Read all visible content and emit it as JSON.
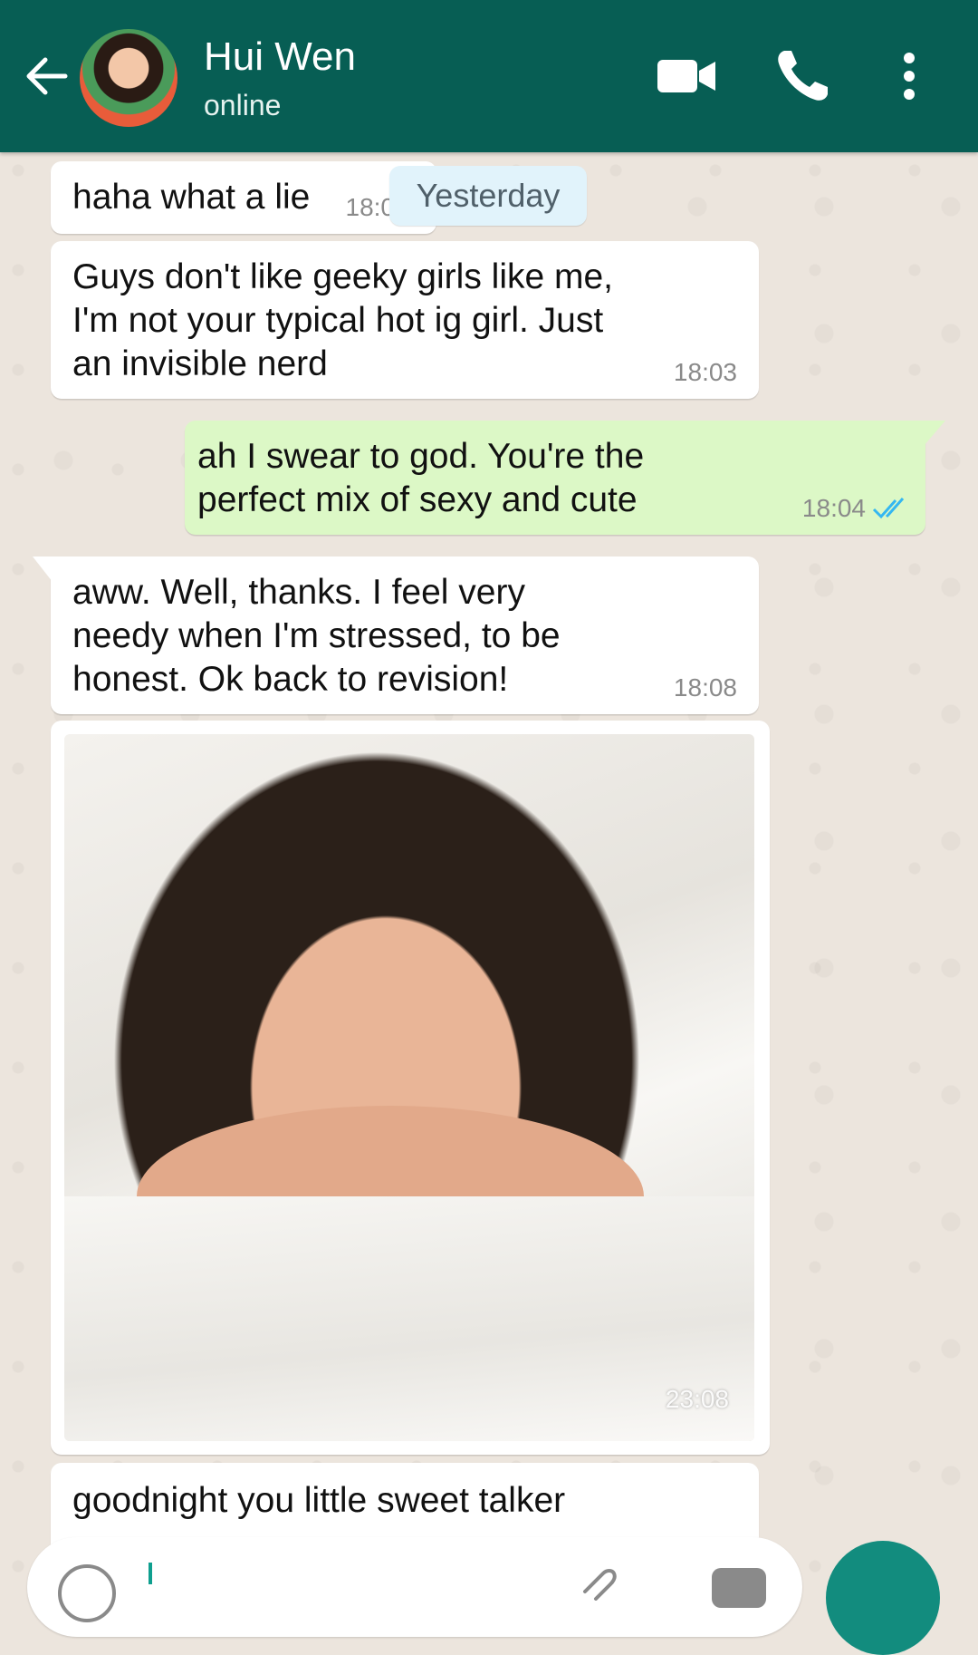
{
  "header": {
    "contact_name": "Hui Wen",
    "status": "online",
    "color": "#075e54"
  },
  "date_separator": "Yesterday",
  "messages": [
    {
      "direction": "in",
      "text": "haha what a lie",
      "time": "18:0"
    },
    {
      "direction": "in",
      "text": "Guys don't like geeky girls like me, I'm not your typical hot ig girl. Just an invisible nerd",
      "time": "18:03"
    },
    {
      "direction": "out",
      "text": "ah I swear to god. You're the perfect mix of sexy and cute",
      "time": "18:04",
      "status": "read"
    },
    {
      "direction": "in",
      "text": "aww. Well, thanks. I feel very needy when I'm stressed, to be honest. Ok back to revision!",
      "time": "18:08"
    },
    {
      "direction": "in",
      "type": "photo",
      "time": "23:08"
    },
    {
      "direction": "in",
      "text": "goodnight you little sweet talker"
    }
  ],
  "icons": {
    "back": "arrow-left-icon",
    "video": "video-camera-icon",
    "call": "phone-icon",
    "menu": "more-vertical-icon",
    "emoji": "emoji-icon",
    "attach": "paperclip-icon",
    "camera": "camera-icon",
    "mic": "microphone-icon"
  },
  "colors": {
    "incoming_bubble": "#ffffff",
    "outgoing_bubble": "#dcf8c6",
    "read_ticks": "#34b7f1",
    "send_button": "#128c7e"
  }
}
